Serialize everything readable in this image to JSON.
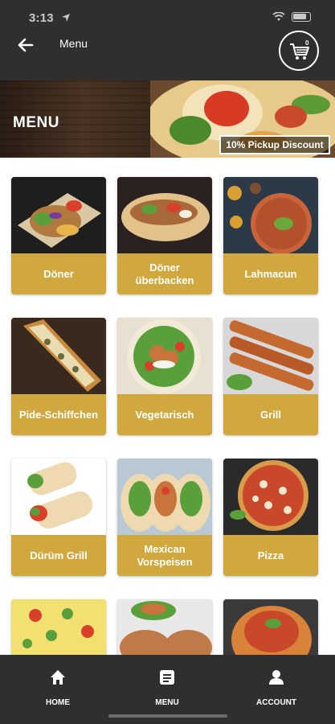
{
  "status_bar": {
    "time": "3:13"
  },
  "header": {
    "title": "Menu",
    "cart_count": "0"
  },
  "banner": {
    "title": "MENU",
    "discount": "10% Pickup Discount"
  },
  "menu_items": [
    {
      "label": "Döner",
      "image": "doner-fries-plate"
    },
    {
      "label": "Döner überbacken",
      "image": "doner-flatbread"
    },
    {
      "label": "Lahmacun",
      "image": "lahmacun-pizza"
    },
    {
      "label": "Pide-Schiffchen",
      "image": "pide-boat"
    },
    {
      "label": "Vegetarisch",
      "image": "vegetarian-wrap"
    },
    {
      "label": "Grill",
      "image": "grill-skewers"
    },
    {
      "label": "Dürüm Grill",
      "image": "durum-wrap"
    },
    {
      "label": "Mexican Vorspeisen",
      "image": "tacos"
    },
    {
      "label": "Pizza",
      "image": "pizza"
    },
    {
      "label": "",
      "image": "gratin"
    },
    {
      "label": "",
      "image": "stuffed-pita"
    },
    {
      "label": "",
      "image": "spaghetti"
    }
  ],
  "bottom_nav": {
    "home": "HOME",
    "menu": "MENU",
    "account": "ACCOUNT"
  },
  "colors": {
    "accent": "#d0a83e",
    "dark": "#2f2f2f"
  }
}
